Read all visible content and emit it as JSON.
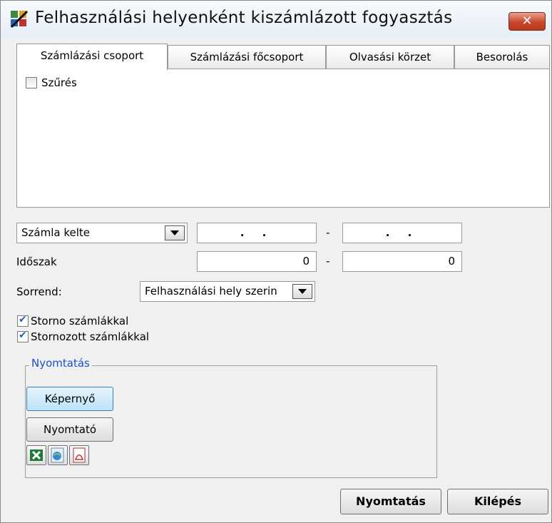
{
  "window": {
    "title": "Felhasználási helyenként kiszámlázott fogyasztás",
    "close_label": "✕"
  },
  "tabs": [
    {
      "label": "Számlázási csoport",
      "active": true
    },
    {
      "label": "Számlázási főcsoport",
      "active": false
    },
    {
      "label": "Olvasási körzet",
      "active": false
    },
    {
      "label": "Besorolás",
      "active": false
    }
  ],
  "filter": {
    "label": "Szűrés",
    "checked": false
  },
  "date_type": {
    "selected": "Számla kelte",
    "from": ".  .",
    "to": ".  .",
    "separator": "-"
  },
  "period": {
    "label": "Időszak",
    "from": "0",
    "to": "0",
    "separator": "-"
  },
  "order": {
    "label": "Sorrend:",
    "selected": "Felhasználási hely szerin"
  },
  "options": {
    "storno_label": "Storno számlákkal",
    "storno_checked": true,
    "stornozott_label": "Stornozott számlákkal",
    "stornozott_checked": true
  },
  "print_group": {
    "title": "Nyomtatás",
    "screen_label": "Képernyő",
    "printer_label": "Nyomtató",
    "export_icons": [
      "excel-icon",
      "html-export-icon",
      "pdf-icon"
    ]
  },
  "footer": {
    "print_label": "Nyomtatás",
    "exit_label": "Kilépés"
  },
  "colors": {
    "accent": "#1a50d0",
    "close": "#c9462a",
    "check": "#2b5fb6"
  }
}
